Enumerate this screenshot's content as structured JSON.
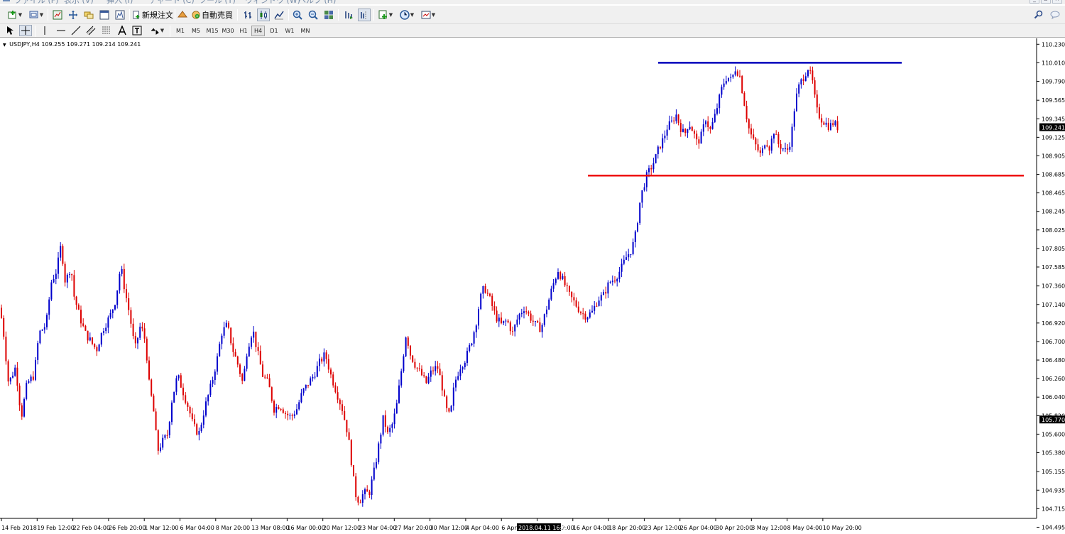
{
  "menu": {
    "items": [
      "ファイル (F)",
      "表示 (V)",
      "挿入 (I)",
      "チャート (C)",
      "ツール (T)",
      "ウィンドウ (W)",
      "ヘルプ (H)"
    ]
  },
  "toolbar": {
    "new_order_label": "新規注文",
    "auto_trading_label": "自動売買"
  },
  "timeframes": [
    "M1",
    "M5",
    "M15",
    "M30",
    "H1",
    "H4",
    "D1",
    "W1",
    "MN"
  ],
  "active_timeframe": "H4",
  "chart_info": {
    "symbol": "USDJPY,H4",
    "ohlc": "109.255 109.271 109.214 109.241"
  },
  "colors": {
    "bull": "#0000cc",
    "bear": "#dd0000",
    "resistance_line": "#0000bb",
    "support_line": "#ee0000"
  },
  "chart_data": {
    "type": "candlestick",
    "ylim": [
      104.6,
      110.3
    ],
    "y_ticks": [
      "110.230",
      "110.010",
      "109.790",
      "109.565",
      "109.345",
      "109.125",
      "108.905",
      "108.685",
      "108.465",
      "108.245",
      "108.025",
      "107.805",
      "107.585",
      "107.360",
      "107.140",
      "106.920",
      "106.700",
      "106.480",
      "106.260",
      "106.040",
      "105.820",
      "105.600",
      "105.380",
      "105.155",
      "104.935",
      "104.715",
      "104.495"
    ],
    "x_ticks": [
      "14 Feb 2018",
      "19 Feb 12:00",
      "22 Feb 04:00",
      "26 Feb 20:00",
      "1 Mar 12:00",
      "6 Mar 04:00",
      "8 Mar 20:00",
      "13 Mar 08:00",
      "16 Mar 00:00",
      "20 Mar 12:00",
      "23 Mar 04:00",
      "27 Mar 20:00",
      "30 Mar 12:00",
      "4 Apr 04:00",
      "6 Apr 20:00",
      "11 Apr 12:00",
      "16 Apr 04:00",
      "18 Apr 20:00",
      "23 Apr 12:00",
      "26 Apr 04:00",
      "30 Apr 20:00",
      "3 May 12:00",
      "8 May 04:00",
      "10 May 20:00"
    ],
    "current_price": "109.241",
    "marked_price": "105.770",
    "crosshair_time": "2018.04.11 16:00",
    "resistance_level": 110.01,
    "support_level": 108.67,
    "close_path": [
      [
        0,
        107.1
      ],
      [
        5,
        106.8
      ],
      [
        12,
        106.2
      ],
      [
        22,
        106.4
      ],
      [
        30,
        105.8
      ],
      [
        38,
        106.2
      ],
      [
        48,
        106.3
      ],
      [
        55,
        106.8
      ],
      [
        65,
        106.9
      ],
      [
        72,
        107.4
      ],
      [
        80,
        107.55
      ],
      [
        86,
        107.85
      ],
      [
        92,
        107.4
      ],
      [
        100,
        107.6
      ],
      [
        104,
        107.25
      ],
      [
        112,
        107.0
      ],
      [
        120,
        106.8
      ],
      [
        128,
        106.7
      ],
      [
        136,
        106.6
      ],
      [
        145,
        106.85
      ],
      [
        155,
        107.0
      ],
      [
        163,
        107.2
      ],
      [
        170,
        107.6
      ],
      [
        176,
        107.3
      ],
      [
        183,
        107.0
      ],
      [
        190,
        106.6
      ],
      [
        198,
        106.9
      ],
      [
        205,
        106.7
      ],
      [
        210,
        106.2
      ],
      [
        216,
        105.9
      ],
      [
        222,
        105.4
      ],
      [
        228,
        105.5
      ],
      [
        236,
        105.6
      ],
      [
        242,
        106.0
      ],
      [
        250,
        106.3
      ],
      [
        258,
        106.1
      ],
      [
        266,
        105.9
      ],
      [
        272,
        105.7
      ],
      [
        280,
        105.6
      ],
      [
        288,
        105.9
      ],
      [
        298,
        106.2
      ],
      [
        306,
        106.5
      ],
      [
        312,
        106.8
      ],
      [
        320,
        106.9
      ],
      [
        328,
        106.6
      ],
      [
        336,
        106.4
      ],
      [
        342,
        106.2
      ],
      [
        348,
        106.6
      ],
      [
        356,
        106.85
      ],
      [
        362,
        106.6
      ],
      [
        370,
        106.3
      ],
      [
        378,
        106.2
      ],
      [
        386,
        105.9
      ],
      [
        394,
        105.95
      ],
      [
        402,
        105.85
      ],
      [
        410,
        105.8
      ],
      [
        418,
        105.9
      ],
      [
        426,
        106.1
      ],
      [
        434,
        106.2
      ],
      [
        442,
        106.3
      ],
      [
        450,
        106.45
      ],
      [
        458,
        106.55
      ],
      [
        466,
        106.3
      ],
      [
        474,
        106.1
      ],
      [
        482,
        105.9
      ],
      [
        490,
        105.6
      ],
      [
        496,
        105.2
      ],
      [
        500,
        104.9
      ],
      [
        506,
        104.8
      ],
      [
        512,
        104.9
      ],
      [
        520,
        104.9
      ],
      [
        528,
        105.2
      ],
      [
        534,
        105.5
      ],
      [
        540,
        105.8
      ],
      [
        546,
        105.6
      ],
      [
        552,
        105.7
      ],
      [
        558,
        105.9
      ],
      [
        566,
        106.4
      ],
      [
        572,
        106.8
      ],
      [
        578,
        106.55
      ],
      [
        586,
        106.4
      ],
      [
        594,
        106.3
      ],
      [
        600,
        106.2
      ],
      [
        608,
        106.35
      ],
      [
        616,
        106.4
      ],
      [
        622,
        106.2
      ],
      [
        628,
        105.9
      ],
      [
        634,
        105.8
      ],
      [
        640,
        106.2
      ],
      [
        648,
        106.4
      ],
      [
        656,
        106.5
      ],
      [
        664,
        106.7
      ],
      [
        670,
        106.9
      ],
      [
        676,
        107.2
      ],
      [
        682,
        107.35
      ],
      [
        690,
        107.2
      ],
      [
        698,
        107.0
      ],
      [
        706,
        106.9
      ],
      [
        714,
        106.95
      ],
      [
        722,
        106.8
      ],
      [
        730,
        107.0
      ],
      [
        738,
        107.1
      ],
      [
        746,
        107.0
      ],
      [
        754,
        106.9
      ],
      [
        762,
        106.85
      ],
      [
        770,
        107.1
      ],
      [
        778,
        107.35
      ],
      [
        786,
        107.55
      ],
      [
        794,
        107.4
      ],
      [
        802,
        107.25
      ],
      [
        810,
        107.15
      ],
      [
        818,
        107.05
      ],
      [
        826,
        107.0
      ],
      [
        834,
        107.05
      ],
      [
        842,
        107.2
      ],
      [
        850,
        107.25
      ],
      [
        858,
        107.4
      ],
      [
        866,
        107.45
      ],
      [
        874,
        107.55
      ],
      [
        882,
        107.7
      ],
      [
        890,
        107.8
      ],
      [
        896,
        108.0
      ],
      [
        900,
        108.3
      ],
      [
        905,
        108.5
      ],
      [
        910,
        108.65
      ],
      [
        916,
        108.75
      ],
      [
        922,
        108.85
      ],
      [
        928,
        109.0
      ],
      [
        934,
        109.1
      ],
      [
        940,
        109.25
      ],
      [
        946,
        109.3
      ],
      [
        952,
        109.4
      ],
      [
        958,
        109.25
      ],
      [
        964,
        109.15
      ],
      [
        970,
        109.3
      ],
      [
        976,
        109.2
      ],
      [
        982,
        109.05
      ],
      [
        988,
        109.15
      ],
      [
        994,
        109.35
      ],
      [
        1000,
        109.2
      ],
      [
        1006,
        109.35
      ],
      [
        1012,
        109.55
      ],
      [
        1018,
        109.75
      ],
      [
        1024,
        109.85
      ],
      [
        1030,
        109.8
      ],
      [
        1036,
        109.95
      ],
      [
        1042,
        109.85
      ],
      [
        1048,
        109.55
      ],
      [
        1054,
        109.25
      ],
      [
        1060,
        109.1
      ],
      [
        1066,
        109.0
      ],
      [
        1072,
        108.9
      ],
      [
        1078,
        109.1
      ],
      [
        1084,
        109.0
      ],
      [
        1090,
        109.2
      ],
      [
        1096,
        109.05
      ],
      [
        1102,
        109.0
      ],
      [
        1108,
        108.95
      ],
      [
        1114,
        109.1
      ],
      [
        1120,
        109.55
      ],
      [
        1126,
        109.75
      ],
      [
        1132,
        109.85
      ],
      [
        1138,
        109.95
      ],
      [
        1144,
        109.8
      ],
      [
        1150,
        109.45
      ],
      [
        1156,
        109.35
      ],
      [
        1162,
        109.3
      ],
      [
        1168,
        109.25
      ],
      [
        1174,
        109.3
      ],
      [
        1180,
        109.24
      ]
    ]
  }
}
